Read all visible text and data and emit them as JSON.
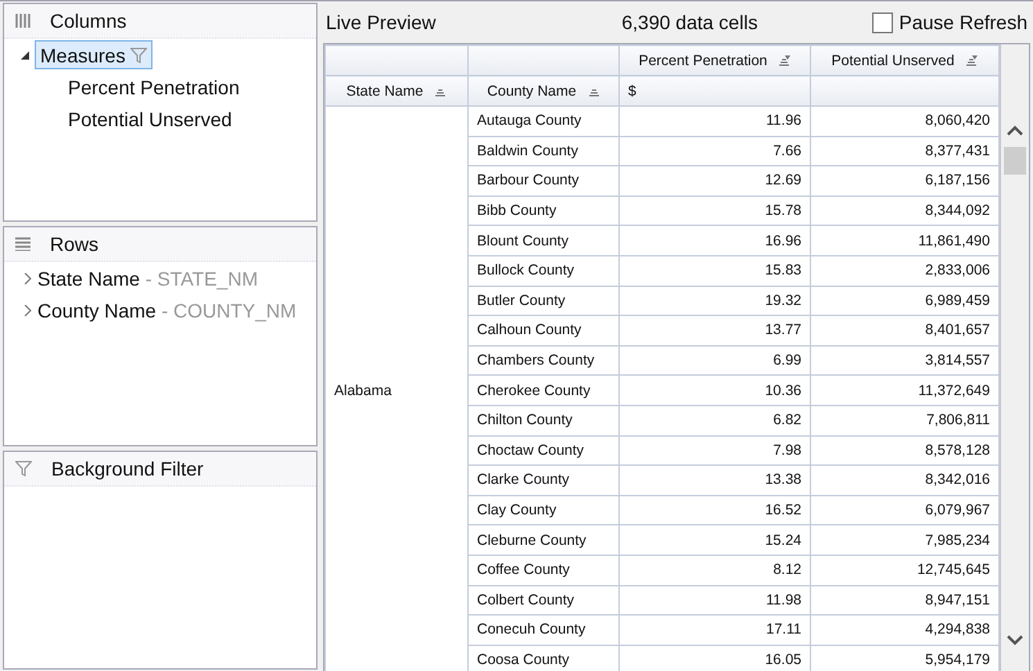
{
  "columns_panel": {
    "title": "Columns",
    "measures": {
      "label": "Measures",
      "expanded": true,
      "selected": true,
      "children": [
        {
          "label": "Percent Penetration"
        },
        {
          "label": "Potential Unserved"
        }
      ]
    }
  },
  "rows_panel": {
    "title": "Rows",
    "items": [
      {
        "label": "State Name",
        "field": "- STATE_NM",
        "expanded": false
      },
      {
        "label": "County Name",
        "field": "- COUNTY_NM",
        "expanded": false
      }
    ]
  },
  "filter_panel": {
    "title": "Background Filter"
  },
  "preview": {
    "title": "Live Preview",
    "cell_count": "6,390 data cells",
    "pause_refresh": {
      "label": "Pause Refresh",
      "checked": false
    }
  },
  "table": {
    "measure_headers": [
      "Percent Penetration",
      "Potential Unserved"
    ],
    "row_headers": [
      "State Name",
      "County Name"
    ],
    "unit": "$",
    "state": "Alabama",
    "rows": [
      [
        "Autauga County",
        "11.96",
        "8,060,420"
      ],
      [
        "Baldwin County",
        "7.66",
        "8,377,431"
      ],
      [
        "Barbour County",
        "12.69",
        "6,187,156"
      ],
      [
        "Bibb County",
        "15.78",
        "8,344,092"
      ],
      [
        "Blount County",
        "16.96",
        "11,861,490"
      ],
      [
        "Bullock County",
        "15.83",
        "2,833,006"
      ],
      [
        "Butler County",
        "19.32",
        "6,989,459"
      ],
      [
        "Calhoun County",
        "13.77",
        "8,401,657"
      ],
      [
        "Chambers County",
        "6.99",
        "3,814,557"
      ],
      [
        "Cherokee County",
        "10.36",
        "11,372,649"
      ],
      [
        "Chilton County",
        "6.82",
        "7,806,811"
      ],
      [
        "Choctaw County",
        "7.98",
        "8,578,128"
      ],
      [
        "Clarke County",
        "13.38",
        "8,342,016"
      ],
      [
        "Clay County",
        "16.52",
        "6,079,967"
      ],
      [
        "Cleburne County",
        "15.24",
        "7,985,234"
      ],
      [
        "Coffee County",
        "8.12",
        "12,745,645"
      ],
      [
        "Colbert County",
        "11.98",
        "8,947,151"
      ],
      [
        "Conecuh County",
        "17.11",
        "4,294,838"
      ],
      [
        "Coosa County",
        "16.05",
        "5,954,179"
      ]
    ]
  }
}
